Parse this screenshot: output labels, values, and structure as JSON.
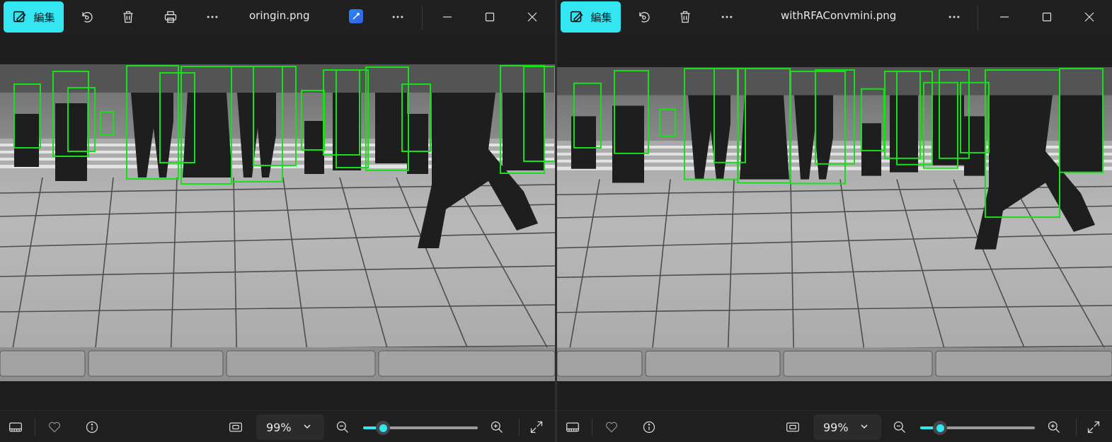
{
  "accent_color": "#33e6f2",
  "box_color": "#18e018",
  "windows": [
    {
      "edit_label": "編集",
      "filename": "oringin.png",
      "zoom": "99%",
      "zoom_slider_fraction": 0.17,
      "icons": [
        "edit-icon",
        "rotate-icon",
        "delete-icon",
        "print-icon",
        "more-icon",
        "app-icon",
        "more-icon",
        "minimize-icon",
        "maximize-icon",
        "close-icon"
      ],
      "status_icons": [
        "filmstrip-icon",
        "favorite-icon",
        "info-icon",
        "fit-icon",
        "zoom-out-icon",
        "zoom-in-icon",
        "fullscreen-icon"
      ]
    },
    {
      "edit_label": "編集",
      "filename": "withRFAConvmini.png",
      "zoom": "99%",
      "zoom_slider_fraction": 0.17,
      "icons": [
        "edit-icon",
        "rotate-icon",
        "delete-icon",
        "more-icon",
        "more-icon",
        "minimize-icon",
        "maximize-icon",
        "close-icon"
      ],
      "status_icons": [
        "filmstrip-icon",
        "favorite-icon",
        "info-icon",
        "fit-icon",
        "zoom-out-icon",
        "zoom-in-icon",
        "fullscreen-icon"
      ]
    }
  ]
}
